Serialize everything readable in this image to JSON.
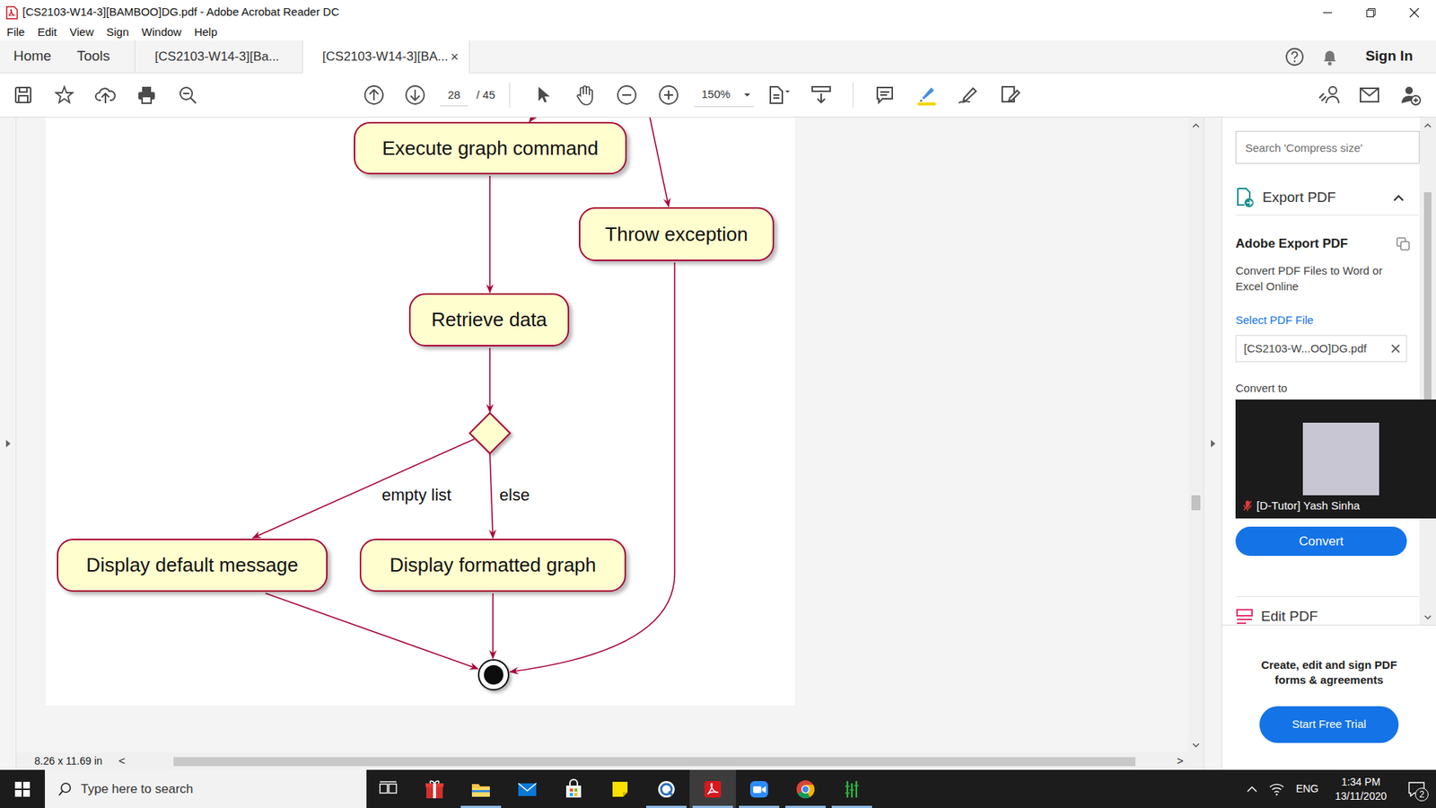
{
  "window": {
    "title": "[CS2103-W14-3][BAMBOO]DG.pdf - Adobe Acrobat Reader DC"
  },
  "menu": [
    "File",
    "Edit",
    "View",
    "Sign",
    "Window",
    "Help"
  ],
  "nav": [
    "Home",
    "Tools"
  ],
  "tabs": [
    {
      "label": "[CS2103-W14-3][Ba...",
      "selected": false
    },
    {
      "label": "[CS2103-W14-3][BA...",
      "selected": true
    }
  ],
  "tab_close": "×",
  "account": {
    "sign_in": "Sign In"
  },
  "toolbar": {
    "page": "28",
    "page_total": "/ 45",
    "zoom": "150%"
  },
  "diagram": {
    "nodes": [
      "Execute graph command",
      "Throw exception",
      "Retrieve data",
      "Display default message",
      "Display formatted graph"
    ],
    "guards": [
      "empty list",
      "else"
    ]
  },
  "status_bar": {
    "page_size": "8.26 x 11.69 in",
    "scroll_left": "<",
    "scroll_right": ">"
  },
  "pane": {
    "search_placeholder": "Search 'Compress size'",
    "section": "Export PDF",
    "heading": "Adobe Export PDF",
    "description": "Convert PDF Files to Word or Excel Online",
    "select_label": "Select PDF File",
    "file": "[CS2103-W...OO]DG.pdf",
    "convert_to": "Convert to",
    "convert_button": "Convert",
    "next_section": "Edit PDF",
    "promo": "Create, edit and sign PDF forms & agreements",
    "trial_button": "Start Free Trial"
  },
  "video": {
    "name": "[D-Tutor] Yash Sinha",
    "muted": true
  },
  "taskbar": {
    "search_placeholder": "Type here to search",
    "apps": [
      {
        "kind": "taskview",
        "running": false,
        "active": false
      },
      {
        "kind": "gift",
        "running": false,
        "active": false
      },
      {
        "kind": "explorer",
        "running": true,
        "active": false
      },
      {
        "kind": "mail",
        "running": false,
        "active": false
      },
      {
        "kind": "store",
        "running": false,
        "active": false
      },
      {
        "kind": "sticky",
        "running": false,
        "active": false
      },
      {
        "kind": "qapp",
        "running": true,
        "active": false
      },
      {
        "kind": "acrobat",
        "running": true,
        "active": true
      },
      {
        "kind": "zoom",
        "running": true,
        "active": false
      },
      {
        "kind": "chrome",
        "running": true,
        "active": false
      },
      {
        "kind": "bamboo",
        "running": true,
        "active": false
      }
    ],
    "language": "ENG",
    "time": "1:34 PM",
    "date": "13/11/2020",
    "notifications": "2"
  }
}
